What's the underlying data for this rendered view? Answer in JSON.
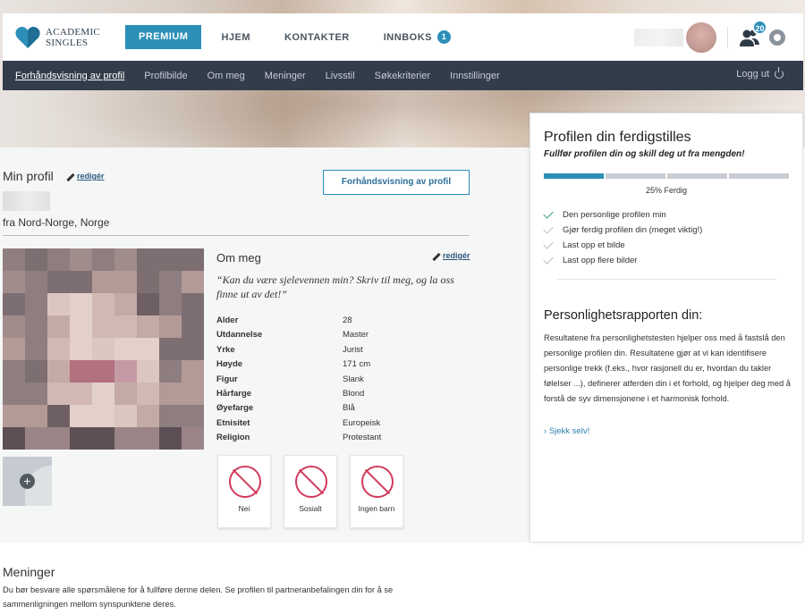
{
  "brand": {
    "line1": "ACADEMIC",
    "line2": "SINGLES"
  },
  "topnav": {
    "premium": "PREMIUM",
    "items": [
      {
        "label": "HJEM"
      },
      {
        "label": "KONTAKTER"
      },
      {
        "label": "INNBOKS",
        "badge": "1"
      }
    ],
    "notifications_count": "20"
  },
  "subnav": {
    "items": [
      "Forhåndsvisning av profil",
      "Profilbilde",
      "Om meg",
      "Meninger",
      "Livsstil",
      "Søkekriterier",
      "Innstillinger"
    ],
    "logout": "Logg ut"
  },
  "profile": {
    "title": "Min profil",
    "edit": "redigér",
    "location": "fra Nord-Norge, Norge",
    "preview_button": "Forhåndsvisning av profil"
  },
  "about": {
    "title": "Om meg",
    "edit": "redigér",
    "quote": "“Kan du være sjelevennen min? Skriv til meg, og la oss finne ut av det!”",
    "facts": [
      {
        "k": "Alder",
        "v": "28"
      },
      {
        "k": "Utdannelse",
        "v": "Master"
      },
      {
        "k": "Yrke",
        "v": "Jurist"
      },
      {
        "k": "Høyde",
        "v": "171 cm"
      },
      {
        "k": "Figur",
        "v": "Slank"
      },
      {
        "k": "Hårfarge",
        "v": "Blond"
      },
      {
        "k": "Øyefarge",
        "v": "Blå"
      },
      {
        "k": "Etnisitet",
        "v": "Europeisk"
      },
      {
        "k": "Religion",
        "v": "Protestant"
      }
    ],
    "cards": [
      {
        "label": "Nei",
        "icon": "no-smoking-icon"
      },
      {
        "label": "Sosialt",
        "icon": "drinking-glass-icon"
      },
      {
        "label": "Ingen barn",
        "icon": "no-children-icon"
      }
    ]
  },
  "panel": {
    "title": "Profilen din ferdigstilles",
    "subtitle": "Fullfør profilen din og skill deg ut fra mengden!",
    "progress_fraction": 0.25,
    "progress_label": "25% Ferdig",
    "checklist": [
      {
        "label": "Den personlige profilen min",
        "done": true
      },
      {
        "label": "Gjør ferdig profilen din (meget viktig!)",
        "done": false
      },
      {
        "label": "Last opp et bilde",
        "done": false
      },
      {
        "label": "Last opp flere bilder",
        "done": false
      }
    ],
    "report_title": "Personlighetsrapporten din:",
    "report_text": "Resultatene fra personlighetstesten hjelper oss med å fastslå den personlige profilen din. Resultatene gjør at vi kan identifisere personlige trekk (f.eks., hvor rasjonell du er, hvordan du takler følelser ...), definerer atferden din i et forhold, og hjelper deg med å forstå de syv dimensjonene i et harmonisk forhold.",
    "check_link": "Sjekk selv!"
  },
  "opinions": {
    "title": "Meninger",
    "text": "Du bør besvare alle spørsmålene for å fullføre denne delen. Se profilen til partneranbefalingen din for å se sammenligningen mellom synspunktene deres."
  },
  "colors": {
    "accent": "#2c8fb8",
    "nav_bg": "#323c4b",
    "alert": "#d23a5c",
    "done": "#3aa07a"
  }
}
